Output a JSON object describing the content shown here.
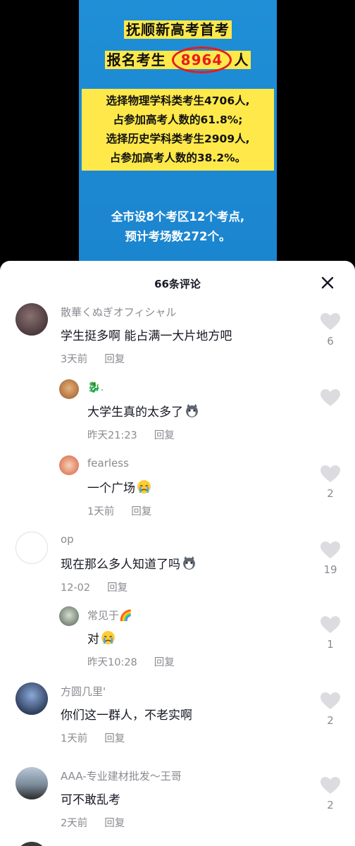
{
  "poster": {
    "line1": "抚顺新高考首考",
    "line2_prefix": "报名考生",
    "line2_number": "8964",
    "line2_suffix": "人",
    "facts": [
      "选择物理学科类考生4706人,",
      "占参加高考人数的61.8%;",
      "选择历史学科类考生2909人,",
      "占参加高考人数的38.2%。"
    ],
    "footer1": "全市设8个考区12个考点,",
    "footer2": "预计考场数272个。"
  },
  "sheet": {
    "title": "66条评论",
    "close_icon": "close-icon",
    "reply_label": "回复"
  },
  "comments": [
    {
      "user": "散華くぬぎオフィシャル",
      "text": "学生挺多啊 能占满一大片地方吧",
      "time": "3天前",
      "likes": "6",
      "avatar_color": "#6b5a5c"
    },
    {
      "user": "🐉.",
      "text": "大学生真的太多了",
      "emoji": "husky-emoji",
      "time": "昨天21:23",
      "likes": "",
      "avatar_color": "#c8925a"
    },
    {
      "user": "fearless",
      "text": "一个广场",
      "emoji": "crying-emoji",
      "time": "1天前",
      "likes": "2",
      "avatar_color": "#e8a58a"
    },
    {
      "user": "op",
      "text": "现在那么多人知道了吗",
      "emoji": "husky-emoji",
      "time": "12-02",
      "likes": "19",
      "avatar_color": "#ffffff"
    },
    {
      "user": "常见于🌈",
      "text": "对",
      "emoji": "crying-emoji",
      "time": "昨天10:28",
      "likes": "1",
      "avatar_color": "#9fa8a0"
    },
    {
      "user": "方圆几里'",
      "text": "你们这一群人，不老实啊",
      "time": "1天前",
      "likes": "2",
      "avatar_color": "#3a4a6a"
    },
    {
      "user": "AAA-专业建材批发～王哥",
      "text": "可不敢乱考",
      "time": "2天前",
      "likes": "2",
      "avatar_color": "#8a99a8"
    }
  ]
}
